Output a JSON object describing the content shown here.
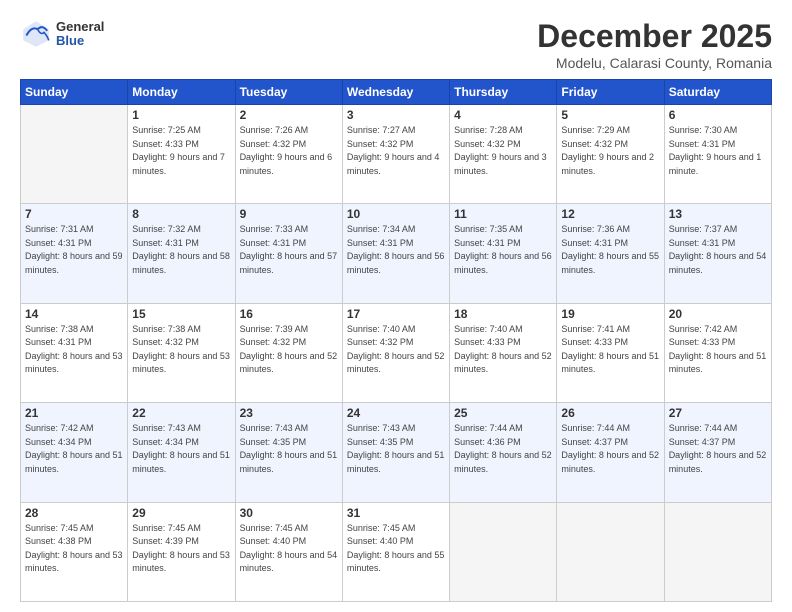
{
  "header": {
    "logo": {
      "general": "General",
      "blue": "Blue"
    },
    "title": "December 2025",
    "location": "Modelu, Calarasi County, Romania"
  },
  "weekdays": [
    "Sunday",
    "Monday",
    "Tuesday",
    "Wednesday",
    "Thursday",
    "Friday",
    "Saturday"
  ],
  "weeks": [
    [
      {
        "day": "",
        "sunrise": "",
        "sunset": "",
        "daylight": ""
      },
      {
        "day": "1",
        "sunrise": "Sunrise: 7:25 AM",
        "sunset": "Sunset: 4:33 PM",
        "daylight": "Daylight: 9 hours and 7 minutes."
      },
      {
        "day": "2",
        "sunrise": "Sunrise: 7:26 AM",
        "sunset": "Sunset: 4:32 PM",
        "daylight": "Daylight: 9 hours and 6 minutes."
      },
      {
        "day": "3",
        "sunrise": "Sunrise: 7:27 AM",
        "sunset": "Sunset: 4:32 PM",
        "daylight": "Daylight: 9 hours and 4 minutes."
      },
      {
        "day": "4",
        "sunrise": "Sunrise: 7:28 AM",
        "sunset": "Sunset: 4:32 PM",
        "daylight": "Daylight: 9 hours and 3 minutes."
      },
      {
        "day": "5",
        "sunrise": "Sunrise: 7:29 AM",
        "sunset": "Sunset: 4:32 PM",
        "daylight": "Daylight: 9 hours and 2 minutes."
      },
      {
        "day": "6",
        "sunrise": "Sunrise: 7:30 AM",
        "sunset": "Sunset: 4:31 PM",
        "daylight": "Daylight: 9 hours and 1 minute."
      }
    ],
    [
      {
        "day": "7",
        "sunrise": "Sunrise: 7:31 AM",
        "sunset": "Sunset: 4:31 PM",
        "daylight": "Daylight: 8 hours and 59 minutes."
      },
      {
        "day": "8",
        "sunrise": "Sunrise: 7:32 AM",
        "sunset": "Sunset: 4:31 PM",
        "daylight": "Daylight: 8 hours and 58 minutes."
      },
      {
        "day": "9",
        "sunrise": "Sunrise: 7:33 AM",
        "sunset": "Sunset: 4:31 PM",
        "daylight": "Daylight: 8 hours and 57 minutes."
      },
      {
        "day": "10",
        "sunrise": "Sunrise: 7:34 AM",
        "sunset": "Sunset: 4:31 PM",
        "daylight": "Daylight: 8 hours and 56 minutes."
      },
      {
        "day": "11",
        "sunrise": "Sunrise: 7:35 AM",
        "sunset": "Sunset: 4:31 PM",
        "daylight": "Daylight: 8 hours and 56 minutes."
      },
      {
        "day": "12",
        "sunrise": "Sunrise: 7:36 AM",
        "sunset": "Sunset: 4:31 PM",
        "daylight": "Daylight: 8 hours and 55 minutes."
      },
      {
        "day": "13",
        "sunrise": "Sunrise: 7:37 AM",
        "sunset": "Sunset: 4:31 PM",
        "daylight": "Daylight: 8 hours and 54 minutes."
      }
    ],
    [
      {
        "day": "14",
        "sunrise": "Sunrise: 7:38 AM",
        "sunset": "Sunset: 4:31 PM",
        "daylight": "Daylight: 8 hours and 53 minutes."
      },
      {
        "day": "15",
        "sunrise": "Sunrise: 7:38 AM",
        "sunset": "Sunset: 4:32 PM",
        "daylight": "Daylight: 8 hours and 53 minutes."
      },
      {
        "day": "16",
        "sunrise": "Sunrise: 7:39 AM",
        "sunset": "Sunset: 4:32 PM",
        "daylight": "Daylight: 8 hours and 52 minutes."
      },
      {
        "day": "17",
        "sunrise": "Sunrise: 7:40 AM",
        "sunset": "Sunset: 4:32 PM",
        "daylight": "Daylight: 8 hours and 52 minutes."
      },
      {
        "day": "18",
        "sunrise": "Sunrise: 7:40 AM",
        "sunset": "Sunset: 4:33 PM",
        "daylight": "Daylight: 8 hours and 52 minutes."
      },
      {
        "day": "19",
        "sunrise": "Sunrise: 7:41 AM",
        "sunset": "Sunset: 4:33 PM",
        "daylight": "Daylight: 8 hours and 51 minutes."
      },
      {
        "day": "20",
        "sunrise": "Sunrise: 7:42 AM",
        "sunset": "Sunset: 4:33 PM",
        "daylight": "Daylight: 8 hours and 51 minutes."
      }
    ],
    [
      {
        "day": "21",
        "sunrise": "Sunrise: 7:42 AM",
        "sunset": "Sunset: 4:34 PM",
        "daylight": "Daylight: 8 hours and 51 minutes."
      },
      {
        "day": "22",
        "sunrise": "Sunrise: 7:43 AM",
        "sunset": "Sunset: 4:34 PM",
        "daylight": "Daylight: 8 hours and 51 minutes."
      },
      {
        "day": "23",
        "sunrise": "Sunrise: 7:43 AM",
        "sunset": "Sunset: 4:35 PM",
        "daylight": "Daylight: 8 hours and 51 minutes."
      },
      {
        "day": "24",
        "sunrise": "Sunrise: 7:43 AM",
        "sunset": "Sunset: 4:35 PM",
        "daylight": "Daylight: 8 hours and 51 minutes."
      },
      {
        "day": "25",
        "sunrise": "Sunrise: 7:44 AM",
        "sunset": "Sunset: 4:36 PM",
        "daylight": "Daylight: 8 hours and 52 minutes."
      },
      {
        "day": "26",
        "sunrise": "Sunrise: 7:44 AM",
        "sunset": "Sunset: 4:37 PM",
        "daylight": "Daylight: 8 hours and 52 minutes."
      },
      {
        "day": "27",
        "sunrise": "Sunrise: 7:44 AM",
        "sunset": "Sunset: 4:37 PM",
        "daylight": "Daylight: 8 hours and 52 minutes."
      }
    ],
    [
      {
        "day": "28",
        "sunrise": "Sunrise: 7:45 AM",
        "sunset": "Sunset: 4:38 PM",
        "daylight": "Daylight: 8 hours and 53 minutes."
      },
      {
        "day": "29",
        "sunrise": "Sunrise: 7:45 AM",
        "sunset": "Sunset: 4:39 PM",
        "daylight": "Daylight: 8 hours and 53 minutes."
      },
      {
        "day": "30",
        "sunrise": "Sunrise: 7:45 AM",
        "sunset": "Sunset: 4:40 PM",
        "daylight": "Daylight: 8 hours and 54 minutes."
      },
      {
        "day": "31",
        "sunrise": "Sunrise: 7:45 AM",
        "sunset": "Sunset: 4:40 PM",
        "daylight": "Daylight: 8 hours and 55 minutes."
      },
      {
        "day": "",
        "sunrise": "",
        "sunset": "",
        "daylight": ""
      },
      {
        "day": "",
        "sunrise": "",
        "sunset": "",
        "daylight": ""
      },
      {
        "day": "",
        "sunrise": "",
        "sunset": "",
        "daylight": ""
      }
    ]
  ]
}
